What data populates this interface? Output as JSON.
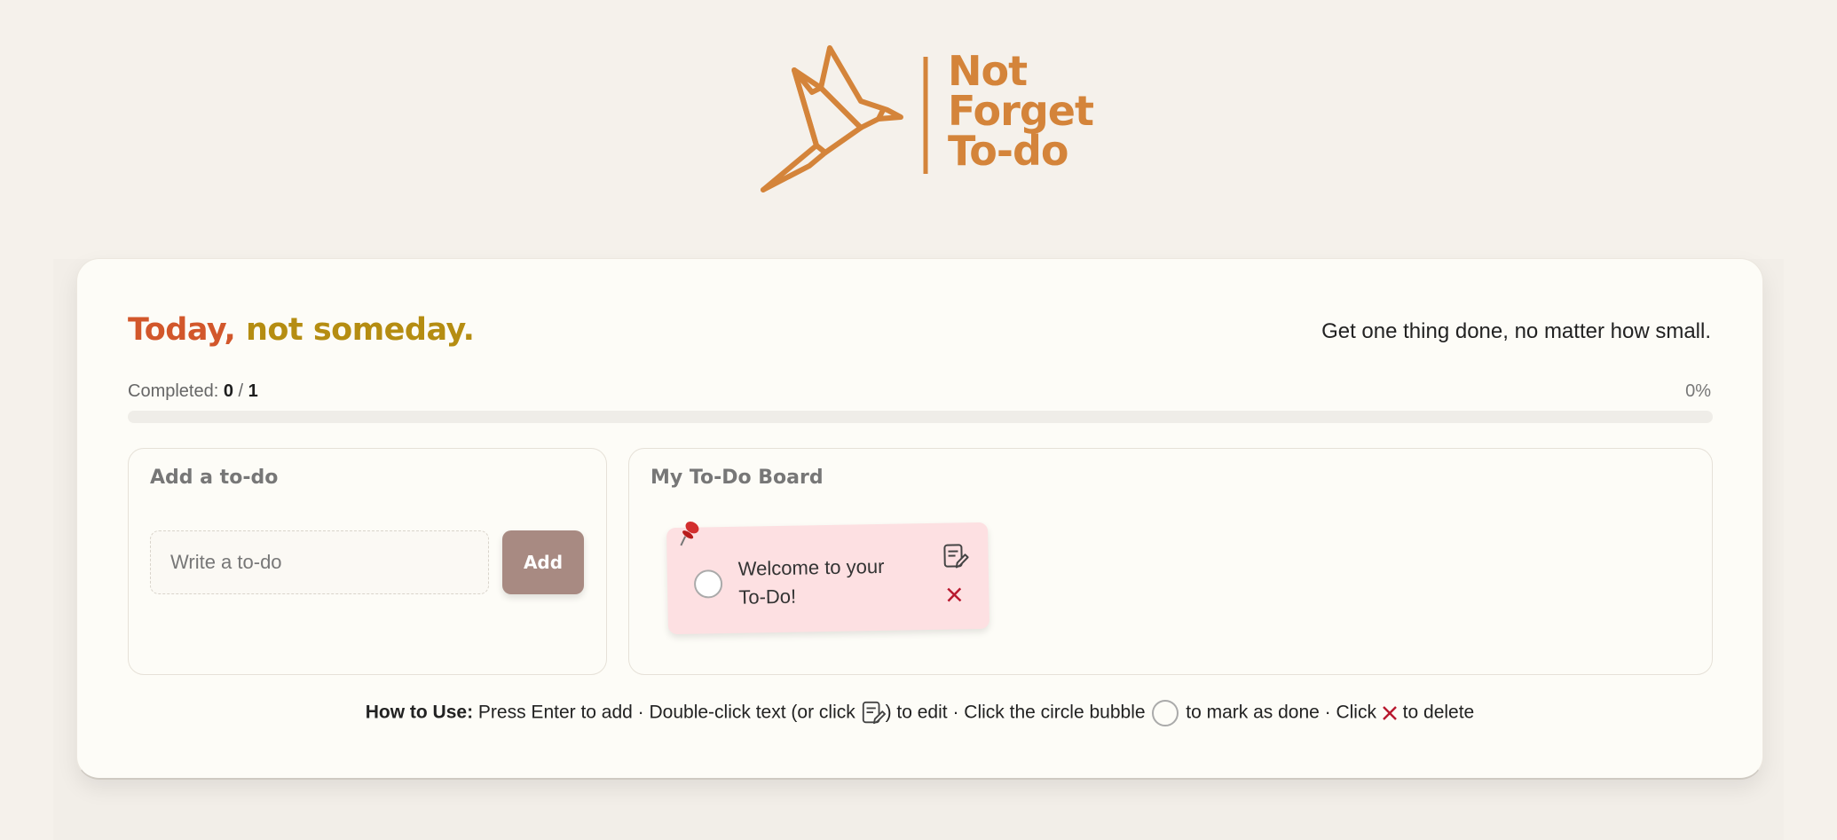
{
  "header": {
    "logo_lines": [
      "Not",
      "Forget",
      "To-do"
    ],
    "logo_icon": "origami-bird-icon",
    "brand_color": "#d4843a"
  },
  "card": {
    "tagline_part1": "Today,",
    "tagline_part2": "not someday.",
    "motto": "Get one thing done, no matter how small.",
    "completed_label": "Completed:",
    "completed_done": "0",
    "completed_separator": "/",
    "completed_total": "1",
    "progress_percent_label": "0%",
    "progress_value": 0
  },
  "add_panel": {
    "title": "Add a to-do",
    "input_placeholder": "Write a to-do",
    "input_value": "",
    "add_button_label": "Add"
  },
  "board": {
    "title": "My To-Do Board",
    "notes": [
      {
        "text": "Welcome to your To-Do!",
        "color": "#fde0e2",
        "done": false
      }
    ]
  },
  "howto": {
    "label": "How to Use:",
    "part1": "Press Enter to add · Double-click text (or click",
    "part2": ") to edit · Click the circle bubble",
    "part3": "to mark as done · Click",
    "part4": "to delete"
  },
  "colors": {
    "tagline_a": "#d2572b",
    "tagline_b": "#b58d12",
    "add_button": "#a88a82",
    "delete": "#b8192f"
  }
}
